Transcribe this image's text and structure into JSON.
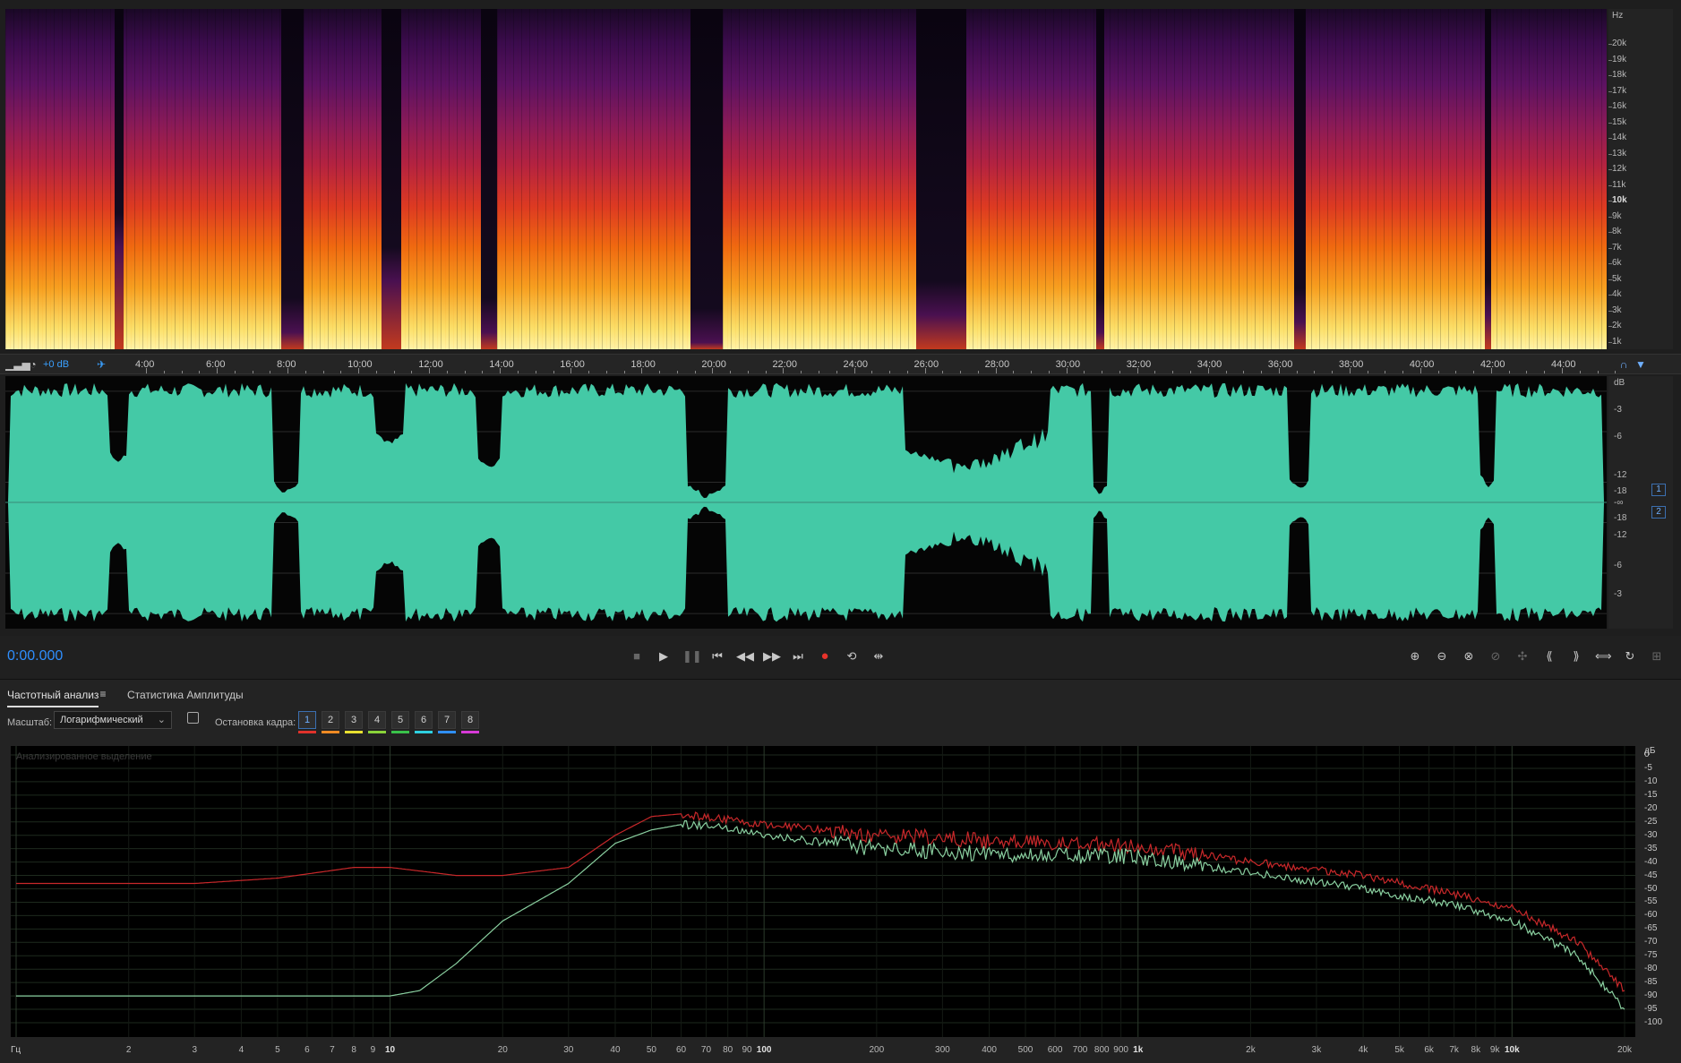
{
  "spectrogram": {
    "hz_unit": "Hz",
    "hz_labels": [
      "20k",
      "19k",
      "18k",
      "17k",
      "16k",
      "15k",
      "14k",
      "13k",
      "12k",
      "11k",
      "10k",
      "9k",
      "8k",
      "7k",
      "6k",
      "5k",
      "4k",
      "3k",
      "2k",
      "1k"
    ],
    "hz_bold": "10k",
    "gaps": [
      {
        "from": 0.068,
        "to": 0.074,
        "depth": 0.3
      },
      {
        "from": 0.172,
        "to": 0.186,
        "depth": 0.05
      },
      {
        "from": 0.235,
        "to": 0.247,
        "depth": 0.2
      },
      {
        "from": 0.297,
        "to": 0.307,
        "depth": 0.05
      },
      {
        "from": 0.428,
        "to": 0.448,
        "depth": 0.02
      },
      {
        "from": 0.569,
        "to": 0.6,
        "depth": 0.1
      },
      {
        "from": 0.681,
        "to": 0.686,
        "depth": 0.05
      },
      {
        "from": 0.805,
        "to": 0.812,
        "depth": 0.08
      },
      {
        "from": 0.924,
        "to": 0.928,
        "depth": 0.1
      }
    ]
  },
  "timeline": {
    "gain": "+0 dB",
    "labels": [
      "4:00",
      "6:00",
      "8:00",
      "10:00",
      "12:00",
      "14:00",
      "16:00",
      "18:00",
      "20:00",
      "22:00",
      "24:00",
      "26:00",
      "28:00",
      "30:00",
      "32:00",
      "34:00",
      "36:00",
      "38:00",
      "40:00",
      "42:00",
      "44:00"
    ]
  },
  "waveform": {
    "color": "#44c9a6",
    "db_unit": "dB",
    "db_labels_top": [
      "-3",
      "-6",
      "-12",
      "-18"
    ],
    "db_inf": "-∞",
    "db_labels_bottom": [
      "-18",
      "-12",
      "-6",
      "-3"
    ],
    "channels": [
      "1",
      "2"
    ],
    "gaps": [
      {
        "from": 0.068,
        "to": 0.074,
        "depth": 0.3
      },
      {
        "from": 0.17,
        "to": 0.18,
        "depth": 0.05
      },
      {
        "from": 0.234,
        "to": 0.247,
        "depth": 0.45
      },
      {
        "from": 0.297,
        "to": 0.307,
        "depth": 0.25
      },
      {
        "from": 0.428,
        "to": 0.448,
        "depth": 0.02
      },
      {
        "from": 0.565,
        "to": 0.62,
        "depth": 0.3
      },
      {
        "from": 0.681,
        "to": 0.686,
        "depth": 0.05
      },
      {
        "from": 0.805,
        "to": 0.812,
        "depth": 0.08
      },
      {
        "from": 0.924,
        "to": 0.928,
        "depth": 0.1
      }
    ]
  },
  "transport": {
    "time": "0:00.000",
    "buttons": [
      "stop",
      "play",
      "pause",
      "go-to-start",
      "rewind",
      "fast-forward",
      "go-to-end",
      "record",
      "loop",
      "skip-selection"
    ]
  },
  "panel": {
    "tabs": [
      "Частотный анализ",
      "Статистика Амплитуды"
    ],
    "scale_label": "Масштаб:",
    "scale_value": "Логарифмический",
    "frame_hold_label": "Остановка кадра:",
    "frames": [
      "1",
      "2",
      "3",
      "4",
      "5",
      "6",
      "7",
      "8"
    ],
    "frame_colors": [
      "#e0322b",
      "#f08a24",
      "#e8e030",
      "#8ad43a",
      "#3ac24a",
      "#2ed0e0",
      "#2f8fff",
      "#d63ad6"
    ]
  },
  "frequency_chart": {
    "caption": "Анализированное выделение",
    "x_unit": "Гц",
    "y_unit": "дБ",
    "x_labels": [
      "2",
      "3",
      "4",
      "5",
      "6",
      "7",
      "8",
      "9",
      "10",
      "20",
      "30",
      "40",
      "50",
      "60",
      "70",
      "80",
      "90",
      "100",
      "200",
      "300",
      "400",
      "500",
      "600",
      "700",
      "800",
      "900",
      "1k",
      "2k",
      "3k",
      "4k",
      "5k",
      "6k",
      "7k",
      "8k",
      "9k",
      "10k",
      "20k"
    ],
    "x_bold": [
      "10",
      "100",
      "1k",
      "10k"
    ],
    "y_labels": [
      "0",
      "-5",
      "-10",
      "-15",
      "-20",
      "-25",
      "-30",
      "-35",
      "-40",
      "-45",
      "-50",
      "-55",
      "-60",
      "-65",
      "-70",
      "-75",
      "-80",
      "-85",
      "-90",
      "-95",
      "-100"
    ]
  },
  "chart_data": {
    "type": "line",
    "xscale": "log",
    "xlim": [
      1,
      20000
    ],
    "ylim": [
      -100,
      0
    ],
    "xlabel": "Гц",
    "ylabel": "дБ",
    "series": [
      {
        "color": "#c8282a",
        "points": [
          [
            1,
            -48
          ],
          [
            3,
            -48
          ],
          [
            5,
            -46
          ],
          [
            8,
            -42
          ],
          [
            10,
            -42
          ],
          [
            15,
            -45
          ],
          [
            20,
            -45
          ],
          [
            30,
            -42
          ],
          [
            40,
            -30
          ],
          [
            50,
            -23
          ],
          [
            60,
            -22
          ],
          [
            80,
            -24
          ],
          [
            100,
            -26
          ],
          [
            200,
            -30
          ],
          [
            400,
            -32
          ],
          [
            1000,
            -34
          ],
          [
            2000,
            -40
          ],
          [
            4000,
            -45
          ],
          [
            7000,
            -52
          ],
          [
            10000,
            -57
          ],
          [
            15000,
            -70
          ],
          [
            20000,
            -88
          ]
        ]
      },
      {
        "color": "#8ad0a0",
        "points": [
          [
            1,
            -90
          ],
          [
            10,
            -90
          ],
          [
            12,
            -88
          ],
          [
            15,
            -78
          ],
          [
            20,
            -62
          ],
          [
            30,
            -48
          ],
          [
            40,
            -33
          ],
          [
            50,
            -28
          ],
          [
            60,
            -26
          ],
          [
            80,
            -27
          ],
          [
            100,
            -30
          ],
          [
            200,
            -35
          ],
          [
            400,
            -37
          ],
          [
            1000,
            -38
          ],
          [
            2000,
            -44
          ],
          [
            4000,
            -50
          ],
          [
            7000,
            -56
          ],
          [
            10000,
            -62
          ],
          [
            15000,
            -75
          ],
          [
            20000,
            -95
          ]
        ]
      }
    ]
  }
}
